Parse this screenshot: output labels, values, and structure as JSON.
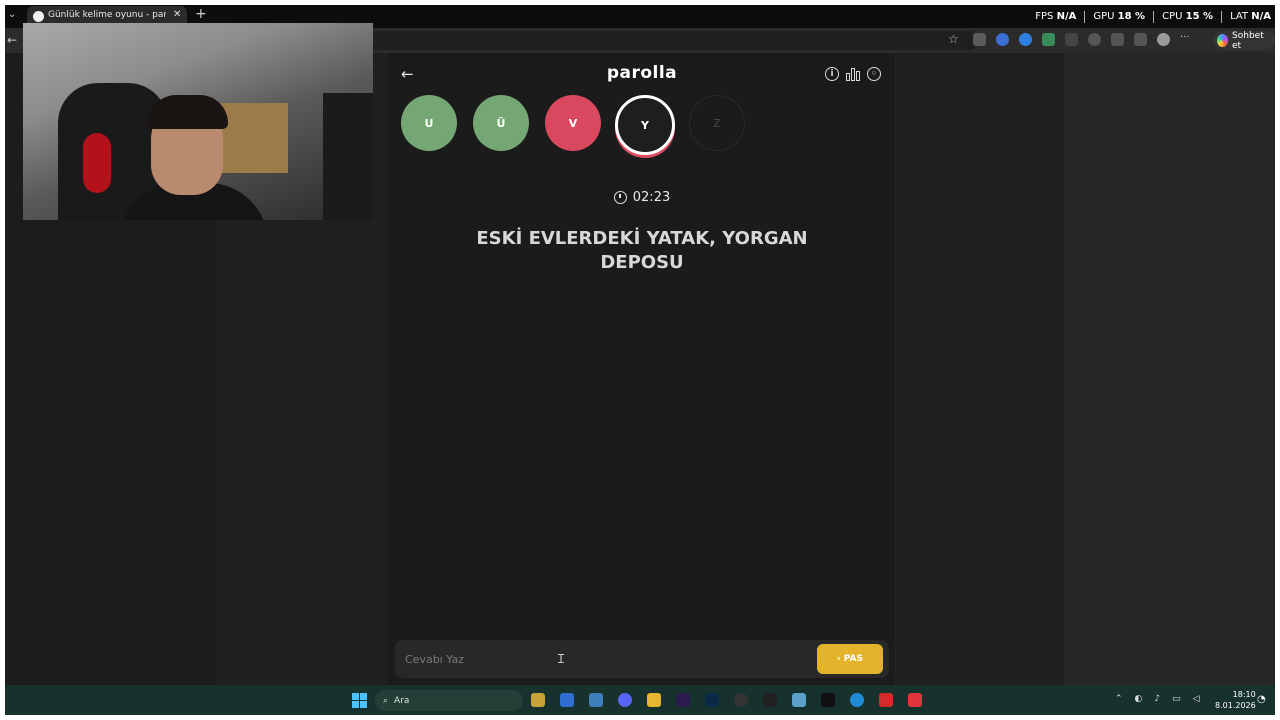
{
  "browser": {
    "tab_title": "Günlük kelime oyunu - parolla - K",
    "tab_close": "✕",
    "new_tab": "+",
    "tab_dropdown": "⌄",
    "back": "←",
    "copilot_label": "Sohbet et"
  },
  "overlay": {
    "fps_label": "FPS",
    "fps_value": "N/A",
    "gpu_label": "GPU",
    "gpu_value": "18",
    "cpu_label": "CPU",
    "cpu_value": "15",
    "lat_label": "LAT",
    "lat_value": "N/A"
  },
  "game": {
    "title": "parolla",
    "back": "←",
    "info_icon": "i",
    "letters": [
      {
        "char": "U",
        "state": "correct"
      },
      {
        "char": "Ü",
        "state": "correct"
      },
      {
        "char": "V",
        "state": "wrong"
      },
      {
        "char": "Y",
        "state": "current"
      },
      {
        "char": "Z",
        "state": "pending"
      }
    ],
    "timer": "02:23",
    "question": "ESKİ EVLERDEKİ YATAK, YORGAN DEPOSU",
    "answer_placeholder": "Cevabı Yaz",
    "pass_label": "PAS",
    "pass_chevron": "›"
  },
  "taskbar": {
    "search_label": "Ara",
    "time": "18:10",
    "date": "8.01.2026"
  },
  "colors": {
    "correct": "#74a774",
    "wrong": "#d9485f",
    "accent": "#e3b42b"
  }
}
